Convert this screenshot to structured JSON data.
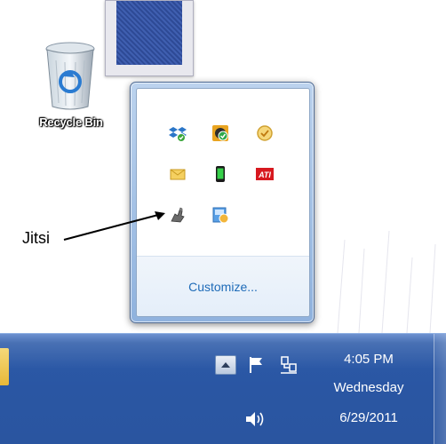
{
  "desktop": {
    "recycle_bin_label": "Recycle Bin"
  },
  "annotation": {
    "label": "Jitsi"
  },
  "flyout": {
    "icons": [
      {
        "name": "dropbox-icon"
      },
      {
        "name": "sync-icon"
      },
      {
        "name": "task-icon"
      },
      {
        "name": "mail-icon"
      },
      {
        "name": "phone-icon"
      },
      {
        "name": "ati-icon",
        "text": "ATI"
      },
      {
        "name": "jitsi-icon"
      },
      {
        "name": "update-icon"
      }
    ],
    "customize_label": "Customize..."
  },
  "taskbar": {
    "clock": {
      "time": "4:05 PM",
      "day": "Wednesday",
      "date": "6/29/2011"
    }
  },
  "colors": {
    "taskbar": "#2a56a3",
    "link": "#1e6bb8",
    "flyout_border": "#4a6894"
  }
}
